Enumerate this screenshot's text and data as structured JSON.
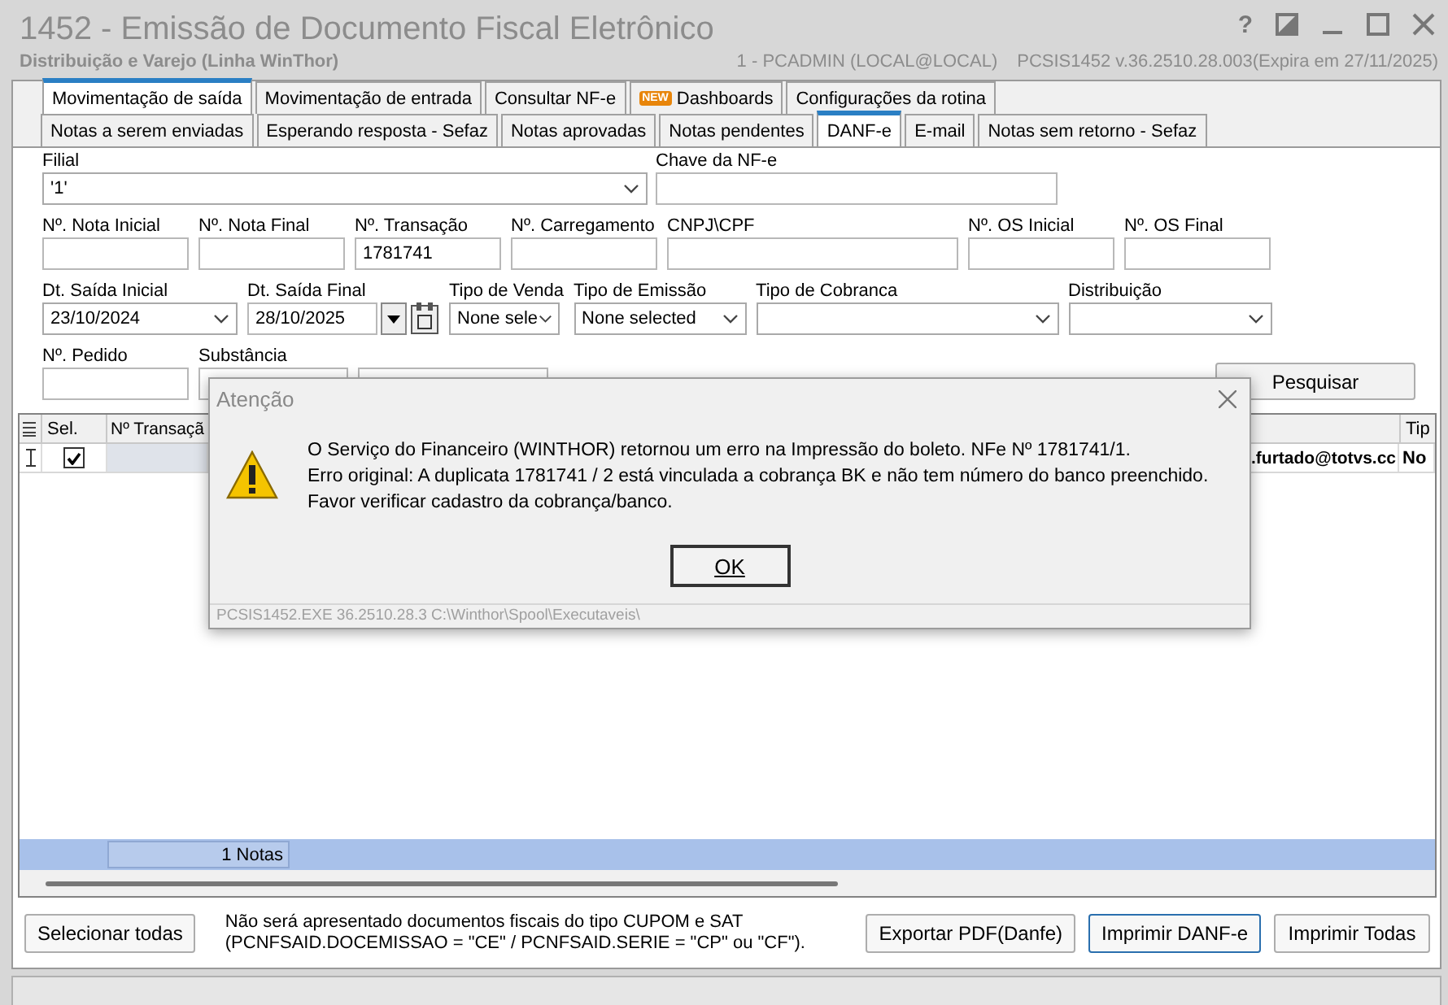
{
  "window": {
    "title": "1452 - Emissão de Documento Fiscal Eletrônico",
    "subtitle": "Distribuição e Varejo (Linha WinThor)",
    "user_info": "1 - PCADMIN (LOCAL@LOCAL)",
    "version": "PCSIS1452  v.36.2510.28.003(Expira em 27/11/2025)",
    "help_glyph": "?"
  },
  "main_tabs": [
    {
      "label": "Movimentação de saída",
      "selected": true
    },
    {
      "label": "Movimentação de entrada",
      "selected": false
    },
    {
      "label": "Consultar NF-e",
      "selected": false
    },
    {
      "label": "Dashboards",
      "badge": "NEW",
      "selected": false
    },
    {
      "label": "Configurações da rotina",
      "selected": false
    }
  ],
  "sub_tabs": [
    {
      "label": "Notas a serem enviadas",
      "selected": false
    },
    {
      "label": "Esperando resposta - Sefaz",
      "selected": false
    },
    {
      "label": "Notas aprovadas",
      "selected": false
    },
    {
      "label": "Notas pendentes",
      "selected": false
    },
    {
      "label": "DANF-e",
      "selected": true
    },
    {
      "label": "E-mail",
      "selected": false
    },
    {
      "label": "Notas sem retorno - Sefaz",
      "selected": false
    }
  ],
  "form": {
    "rows": [
      [
        {
          "kind": "select",
          "label": "Filial",
          "value": "'1'"
        },
        {
          "kind": "text",
          "label": "Chave da NF-e"
        }
      ],
      [
        {
          "kind": "text",
          "label": "Nº. Nota Inicial"
        },
        {
          "kind": "text",
          "label": "Nº. Nota Final"
        },
        {
          "kind": "text",
          "label": "Nº. Transação",
          "value": "1781741"
        },
        {
          "kind": "text",
          "label": "Nº. Carregamento"
        },
        {
          "kind": "text",
          "label": "CNPJ\\CPF"
        },
        {
          "kind": "text",
          "label": "Nº. OS Inicial"
        },
        {
          "kind": "text",
          "label": "Nº. OS Final"
        }
      ],
      [
        {
          "kind": "select",
          "label": "Dt. Saída Inicial",
          "value": "23/10/2024"
        },
        {
          "kind": "date",
          "label": "Dt. Saída Final",
          "value": "28/10/2025"
        },
        {
          "kind": "select",
          "label": "Tipo de Venda",
          "value": "None sele"
        },
        {
          "kind": "select",
          "label": "Tipo de Emissão",
          "value": "None selected"
        },
        {
          "kind": "select",
          "label": "Tipo de Cobranca"
        },
        {
          "kind": "select",
          "label": "Distribuição"
        }
      ],
      [
        {
          "kind": "text",
          "label": "Nº. Pedido"
        },
        {
          "kind": "text",
          "label": "Substância"
        },
        {
          "kind": "box"
        }
      ]
    ],
    "search_button": "Pesquisar"
  },
  "table": {
    "columns": [
      "Sel.",
      "Nº Transaçã",
      "Tip"
    ],
    "rows": [
      {
        "checked": true,
        "email": ".furtado@totvs.cc",
        "type": "No"
      }
    ],
    "footer": "1 Notas"
  },
  "bottom": {
    "select_all": "Selecionar todas",
    "note": [
      "Não será apresentado documentos fiscais do tipo CUPOM e SAT",
      "(PCNFSAID.DOCEMISSAO = \"CE\" / PCNFSAID.SERIE = \"CP\" ou \"CF\")."
    ],
    "buttons": [
      {
        "label": "Exportar PDF(Danfe)",
        "focused": false
      },
      {
        "label": "Imprimir DANF-e",
        "focused": true
      },
      {
        "label": "Imprimir Todas",
        "focused": false
      }
    ]
  },
  "dialog": {
    "title": "Atenção",
    "message": [
      "O Serviço do Financeiro (WINTHOR) retornou um erro na Impressão do boleto. NFe Nº 1781741/1.",
      "Erro original: A duplicata 1781741 / 2 está vinculada a cobrança BK e não tem número do banco preenchido.",
      "Favor verificar cadastro da cobrança/banco."
    ],
    "ok": "OK",
    "footer": "PCSIS1452.EXE 36.2510.28.3 C:\\Winthor\\Spool\\Executaveis\\"
  }
}
